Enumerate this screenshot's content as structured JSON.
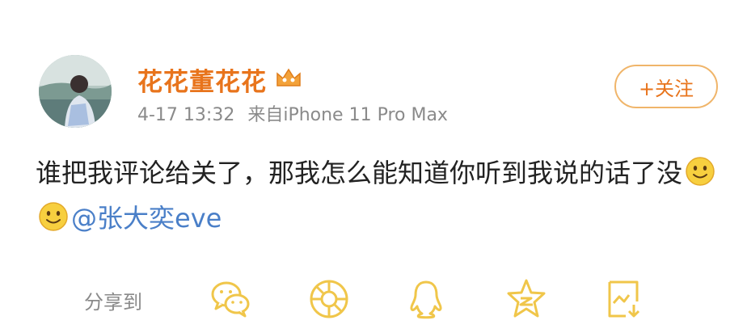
{
  "post": {
    "username": "花花董花花",
    "meta": {
      "timestamp": "4-17 13:32",
      "source": "来自iPhone 11 Pro Max"
    },
    "follow_label": "+关注",
    "text": "谁把我评论给关了，那我怎么能知道你听到我说的话了没",
    "mention": "@张大奕eve"
  },
  "share": {
    "label": "分享到",
    "icons": [
      "wechat-icon",
      "moments-icon",
      "qq-icon",
      "qzone-icon",
      "screenshot-share-icon"
    ]
  },
  "colors": {
    "username": "#e8741c",
    "mention": "#4a7fc8",
    "follow_border": "#f0b56a",
    "share_icon": "#f0c64a"
  }
}
